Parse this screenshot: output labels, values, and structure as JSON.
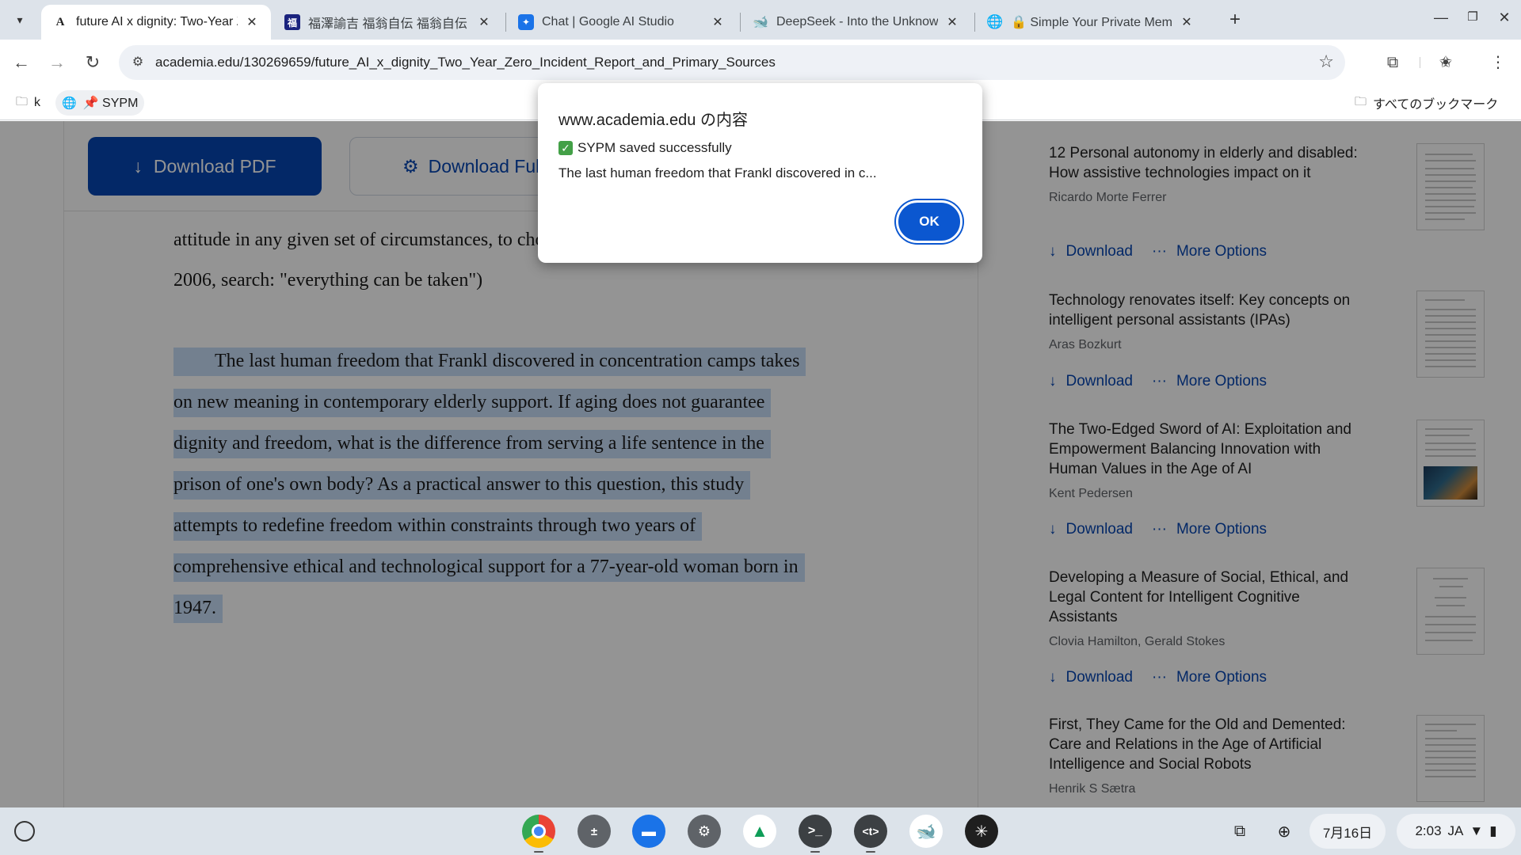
{
  "tabs": [
    {
      "title": "future AI x dignity: Two-Year Zero",
      "favicon": "A"
    },
    {
      "title": "福澤諭吉 福翁自伝 福翁自伝",
      "favicon": "福"
    },
    {
      "title": "Chat | Google AI Studio",
      "favicon": "studio-icon"
    },
    {
      "title": "DeepSeek - Into the Unknown",
      "favicon": "deepseek-icon"
    },
    {
      "title": "🔒 Simple Your Private Memo",
      "favicon": "globe-icon"
    }
  ],
  "toolbar": {
    "url": "academia.edu/130269659/future_AI_x_dignity_Two_Year_Zero_Incident_Report_and_Primary_Sources"
  },
  "bookmarks": {
    "items": [
      {
        "label": "k"
      },
      {
        "label": "📌 SYPM"
      }
    ],
    "all_bookmarks": "すべてのブックマーク"
  },
  "page": {
    "download_pdf": "Download PDF",
    "download_full": "Download Full PDF Package",
    "text_top": [
      "attitude in any given set of circumstances, to choose one's own way.\" (Frankl,",
      "2006, search: \"everything can be taken\")"
    ],
    "text_highlight": [
      "The last human freedom that Frankl discovered in concentration camps takes",
      "on new meaning in contemporary elderly support. If aging does not guarantee",
      "dignity and freedom, what is the difference from serving a life sentence in the",
      "prison of one's own body? As a practical answer to this question, this study",
      "attempts to redefine freedom within constraints through two years of",
      "comprehensive ethical and technological support for a 77-year-old woman born in",
      "1947."
    ]
  },
  "related": {
    "download_label": "Download",
    "more_label": "More Options",
    "items": [
      {
        "title": "12 Personal autonomy in elderly and disabled: How assistive technologies impact on it",
        "author": "Ricardo Morte Ferrer"
      },
      {
        "title": "Technology renovates itself: Key concepts on intelligent personal assistants (IPAs)",
        "author": "Aras Bozkurt"
      },
      {
        "title": "The Two-Edged Sword of AI: Exploitation and Empowerment Balancing Innovation with Human Values in the Age of AI",
        "author": "Kent Pedersen"
      },
      {
        "title": "Developing a Measure of Social, Ethical, and Legal Content for Intelligent Cognitive Assistants",
        "author": "Clovia Hamilton, Gerald Stokes"
      },
      {
        "title": "First, They Came for the Old and Demented: Care and Relations in the Age of Artificial Intelligence and Social Robots",
        "author": "Henrik S Sætra"
      }
    ]
  },
  "dialog": {
    "heading": "www.academia.edu の内容",
    "message1": "SYPM saved successfully",
    "message2": "The last human freedom that Frankl discovered in c...",
    "ok": "OK"
  },
  "shelf": {
    "date": "7月16日",
    "time": "2:03",
    "ime": "JA"
  }
}
